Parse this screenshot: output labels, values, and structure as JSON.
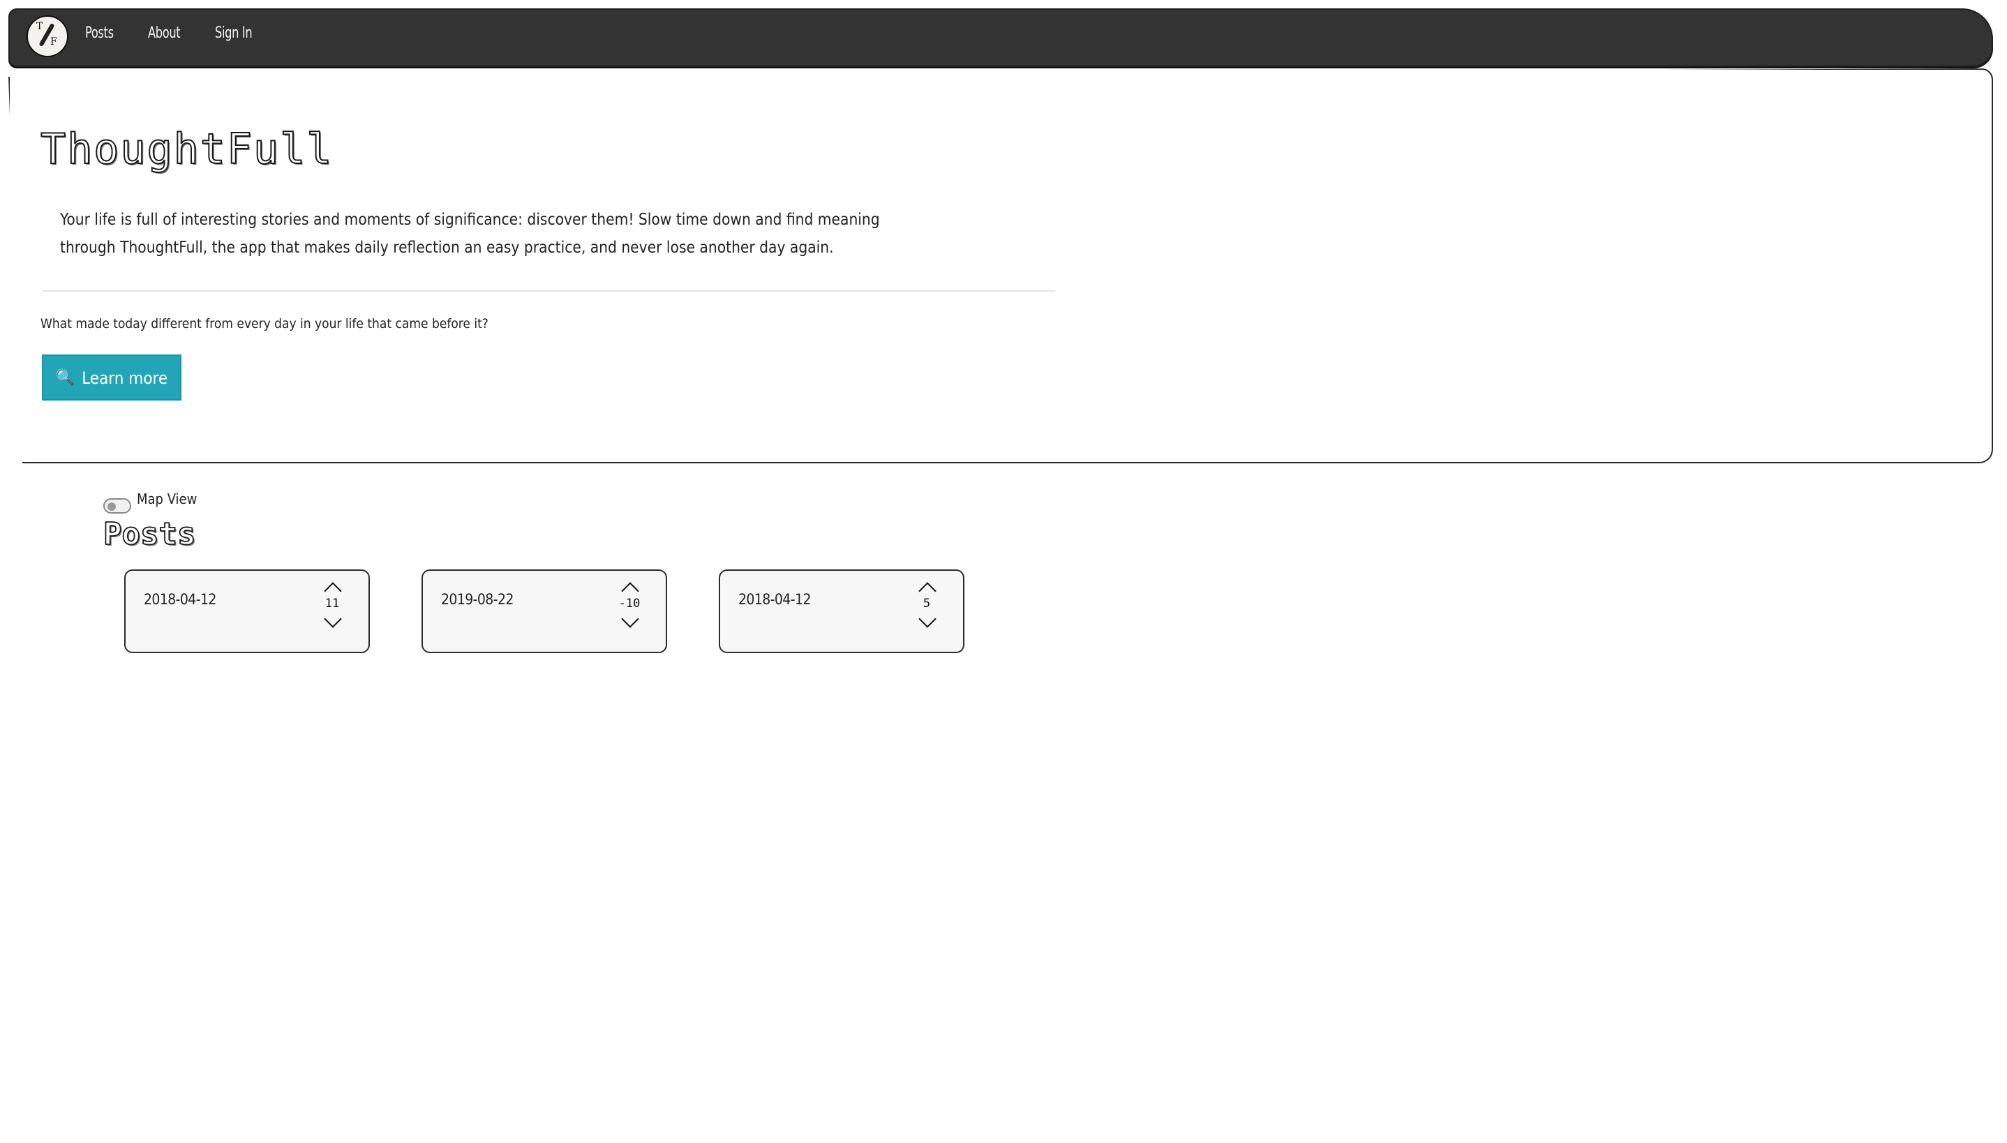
{
  "nav": {
    "logo_letters": {
      "top": "T",
      "bottom": "F"
    },
    "links": [
      "Posts",
      "About",
      "Sign In"
    ]
  },
  "hero": {
    "title": "ThoughtFull",
    "lead": "Your life is full of interesting stories and moments of significance: discover them! Slow time down and find meaning through ThoughtFull, the app that makes daily reflection an easy practice, and never lose another day again.",
    "question": "What made today different from every day in your life that came before it?",
    "button_label": "Learn more",
    "button_icon": "magnifying-glass-icon",
    "button_color": "#22a6b7"
  },
  "toggle": {
    "label": "Map View",
    "on": false
  },
  "posts_heading": "Posts",
  "posts": [
    {
      "date": "2018-04-12",
      "score": "11"
    },
    {
      "date": "2019-08-22",
      "score": "-10"
    },
    {
      "date": "2018-04-12",
      "score": "5"
    }
  ],
  "colors": {
    "navbar": "#333333",
    "accent": "#22a6b7"
  }
}
